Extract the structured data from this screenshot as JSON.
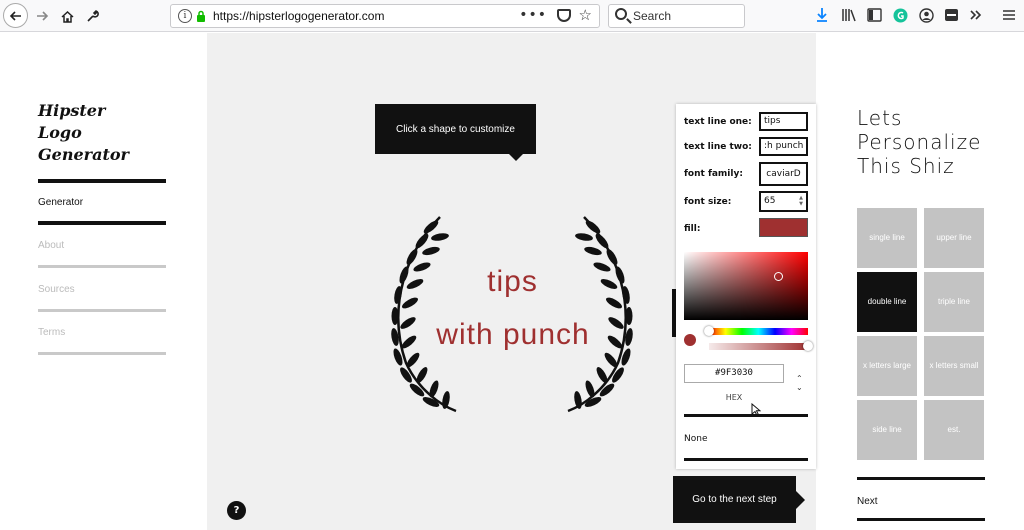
{
  "browser": {
    "url": "https://hipsterlogogenerator.com",
    "search_placeholder": "Search",
    "page_actions": "•••"
  },
  "sidebar": {
    "logo": "Hipster Logo Generator",
    "items": [
      {
        "label": "Generator",
        "active": true
      },
      {
        "label": "About",
        "active": false
      },
      {
        "label": "Sources",
        "active": false
      },
      {
        "label": "Terms",
        "active": false
      }
    ]
  },
  "canvas": {
    "hint": "Click a shape to customize",
    "logo_line_one": "tips",
    "logo_line_two": "with punch",
    "logo_color": "#9F3030",
    "help": "?",
    "next_step": "Go to the next step"
  },
  "customize": {
    "text_line_one_label": "text line one:",
    "text_line_one_value": "tips",
    "text_line_two_label": "text line two:",
    "text_line_two_value": ":h punch",
    "font_family_label": "font family:",
    "font_family_value": "caviarD",
    "font_size_label": "font size:",
    "font_size_value": "65",
    "fill_label": "fill:",
    "fill_color": "#9F3030",
    "picker": {
      "hex_value": "#9F3030",
      "mode": "HEX",
      "none_option": "None",
      "hue_level": 0.0,
      "alpha_level": 1.0
    }
  },
  "personalize": {
    "title": "Lets Personalize This Shiz",
    "layouts": [
      {
        "label": "single line",
        "selected": false
      },
      {
        "label": "upper line",
        "selected": false
      },
      {
        "label": "double line",
        "selected": true
      },
      {
        "label": "triple line",
        "selected": false
      },
      {
        "label": "x letters large",
        "selected": false
      },
      {
        "label": "x letters small",
        "selected": false
      },
      {
        "label": "side line",
        "selected": false
      },
      {
        "label": "est.",
        "selected": false
      }
    ],
    "next": "Next"
  }
}
